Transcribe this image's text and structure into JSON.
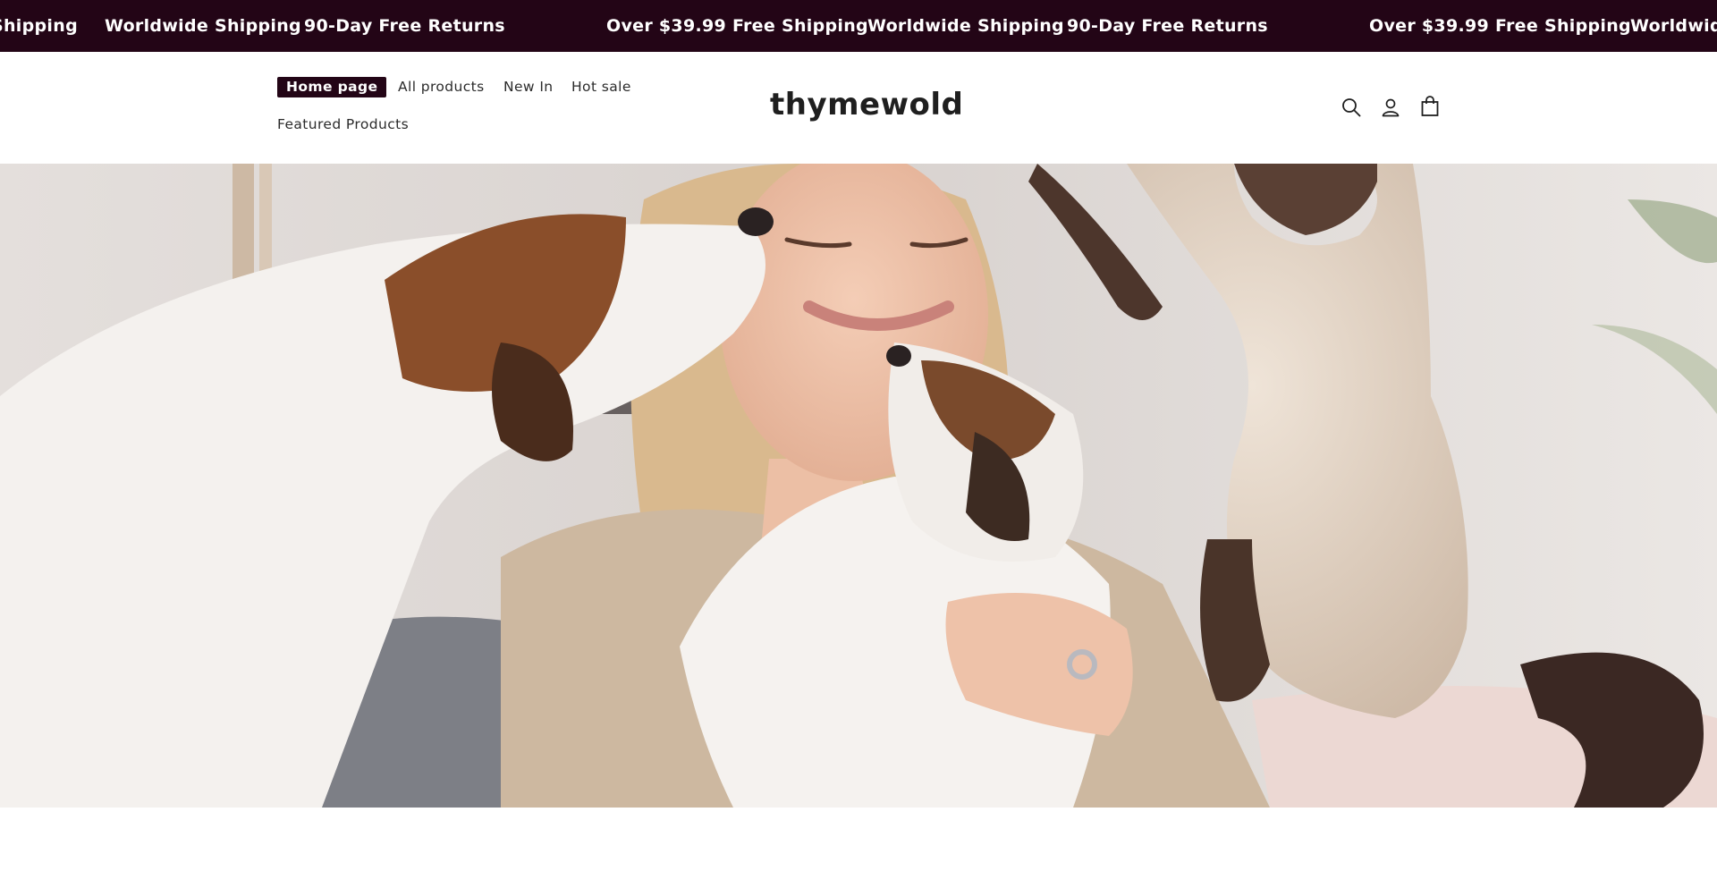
{
  "announcement": {
    "items": [
      "Shipping",
      "Worldwide Shipping",
      "90-Day Free Returns",
      "Over $39.99 Free Shipping",
      "Worldwide Shipping",
      "90-Day Free Returns",
      "Over $39.99 Free Shipping",
      "Worldwid"
    ],
    "background": "#230516",
    "text_color": "#ffffff"
  },
  "header": {
    "brand": "thymewold",
    "nav": [
      {
        "label": "Home page",
        "active": true
      },
      {
        "label": "All products",
        "active": false
      },
      {
        "label": "New In",
        "active": false
      },
      {
        "label": "Hot sale",
        "active": false
      },
      {
        "label": "Featured Products",
        "active": false
      }
    ],
    "icons": [
      "search-icon",
      "account-icon",
      "cart-icon"
    ],
    "accent": "#230516"
  },
  "hero": {
    "image": "woman-with-dogs-and-cat"
  }
}
